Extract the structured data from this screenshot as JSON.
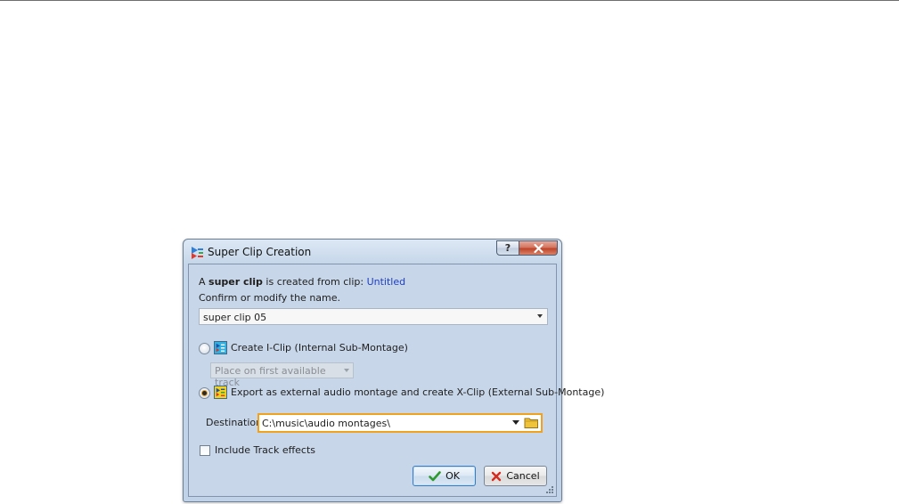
{
  "dialog": {
    "title": "Super Clip Creation",
    "help_label": "?",
    "intro": {
      "prefix": "A ",
      "bold": "super clip",
      "middle": " is created from clip: ",
      "clip_name": "Untitled"
    },
    "instruction": "Confirm or modify the name.",
    "name_combo": {
      "value": "super clip 05"
    },
    "option_iclip": {
      "label": "Create I-Clip (Internal Sub-Montage)",
      "selected": false
    },
    "placement_combo": {
      "value": "Place on first available track",
      "enabled": false
    },
    "option_xclip": {
      "label": "Export as external audio montage and create X-Clip (External Sub-Montage)",
      "selected": true
    },
    "destination": {
      "label": "Destination",
      "value": "C:\\music\\audio montages\\"
    },
    "include_effects": {
      "label": "Include Track effects",
      "checked": false
    },
    "ok_label": "OK",
    "cancel_label": "Cancel"
  },
  "colors": {
    "link": "#1f3fbf",
    "focus_border": "#f2a11d",
    "dialog_bg": "#c7d6e9"
  },
  "icons": {
    "app": "super-clip-icon",
    "iclip": "iclip-montage-icon",
    "xclip": "xclip-montage-icon",
    "folder": "folder-icon",
    "ok": "checkmark-icon",
    "cancel": "red-x-icon",
    "close": "close-icon"
  }
}
